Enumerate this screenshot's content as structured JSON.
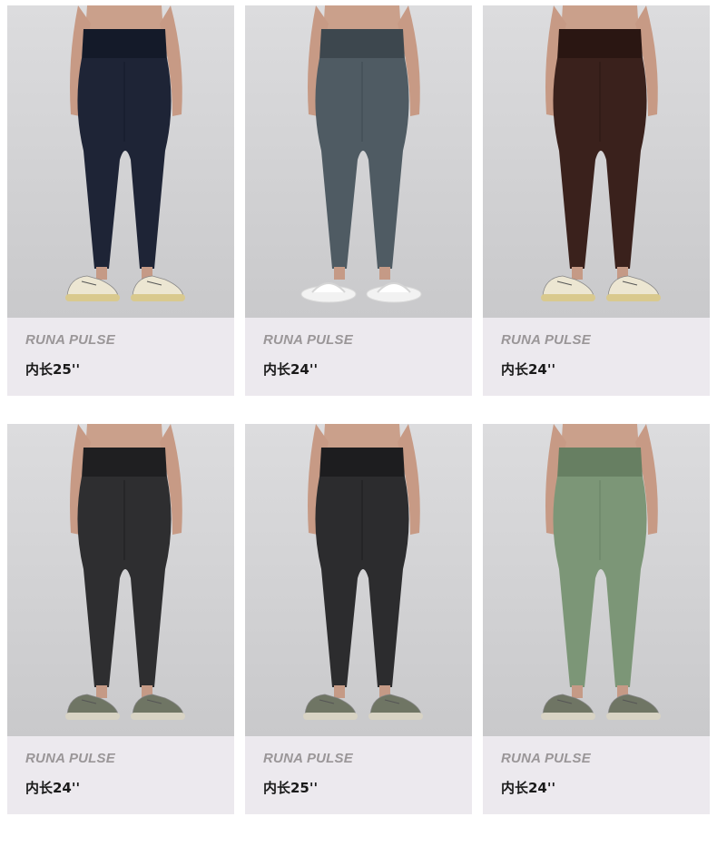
{
  "products": [
    {
      "brand": "RUNA PULSE",
      "inseam": "内长25''",
      "color": "#1e2436",
      "colorDark": "#141a29",
      "shoe": "sneaker-cream"
    },
    {
      "brand": "RUNA PULSE",
      "inseam": "内长24''",
      "color": "#4f5b63",
      "colorDark": "#3d474e",
      "shoe": "slide-white"
    },
    {
      "brand": "RUNA PULSE",
      "inseam": "内长24''",
      "color": "#3a211c",
      "colorDark": "#2a1612",
      "shoe": "sneaker-cream"
    },
    {
      "brand": "RUNA PULSE",
      "inseam": "内长24''",
      "color": "#2e2e30",
      "colorDark": "#1f1f21",
      "shoe": "sneaker-grey"
    },
    {
      "brand": "RUNA PULSE",
      "inseam": "内长25''",
      "color": "#2c2c2e",
      "colorDark": "#1d1d1f",
      "shoe": "sneaker-grey"
    },
    {
      "brand": "RUNA PULSE",
      "inseam": "内长24''",
      "color": "#7c9677",
      "colorDark": "#677f62",
      "shoe": "sneaker-grey"
    }
  ]
}
